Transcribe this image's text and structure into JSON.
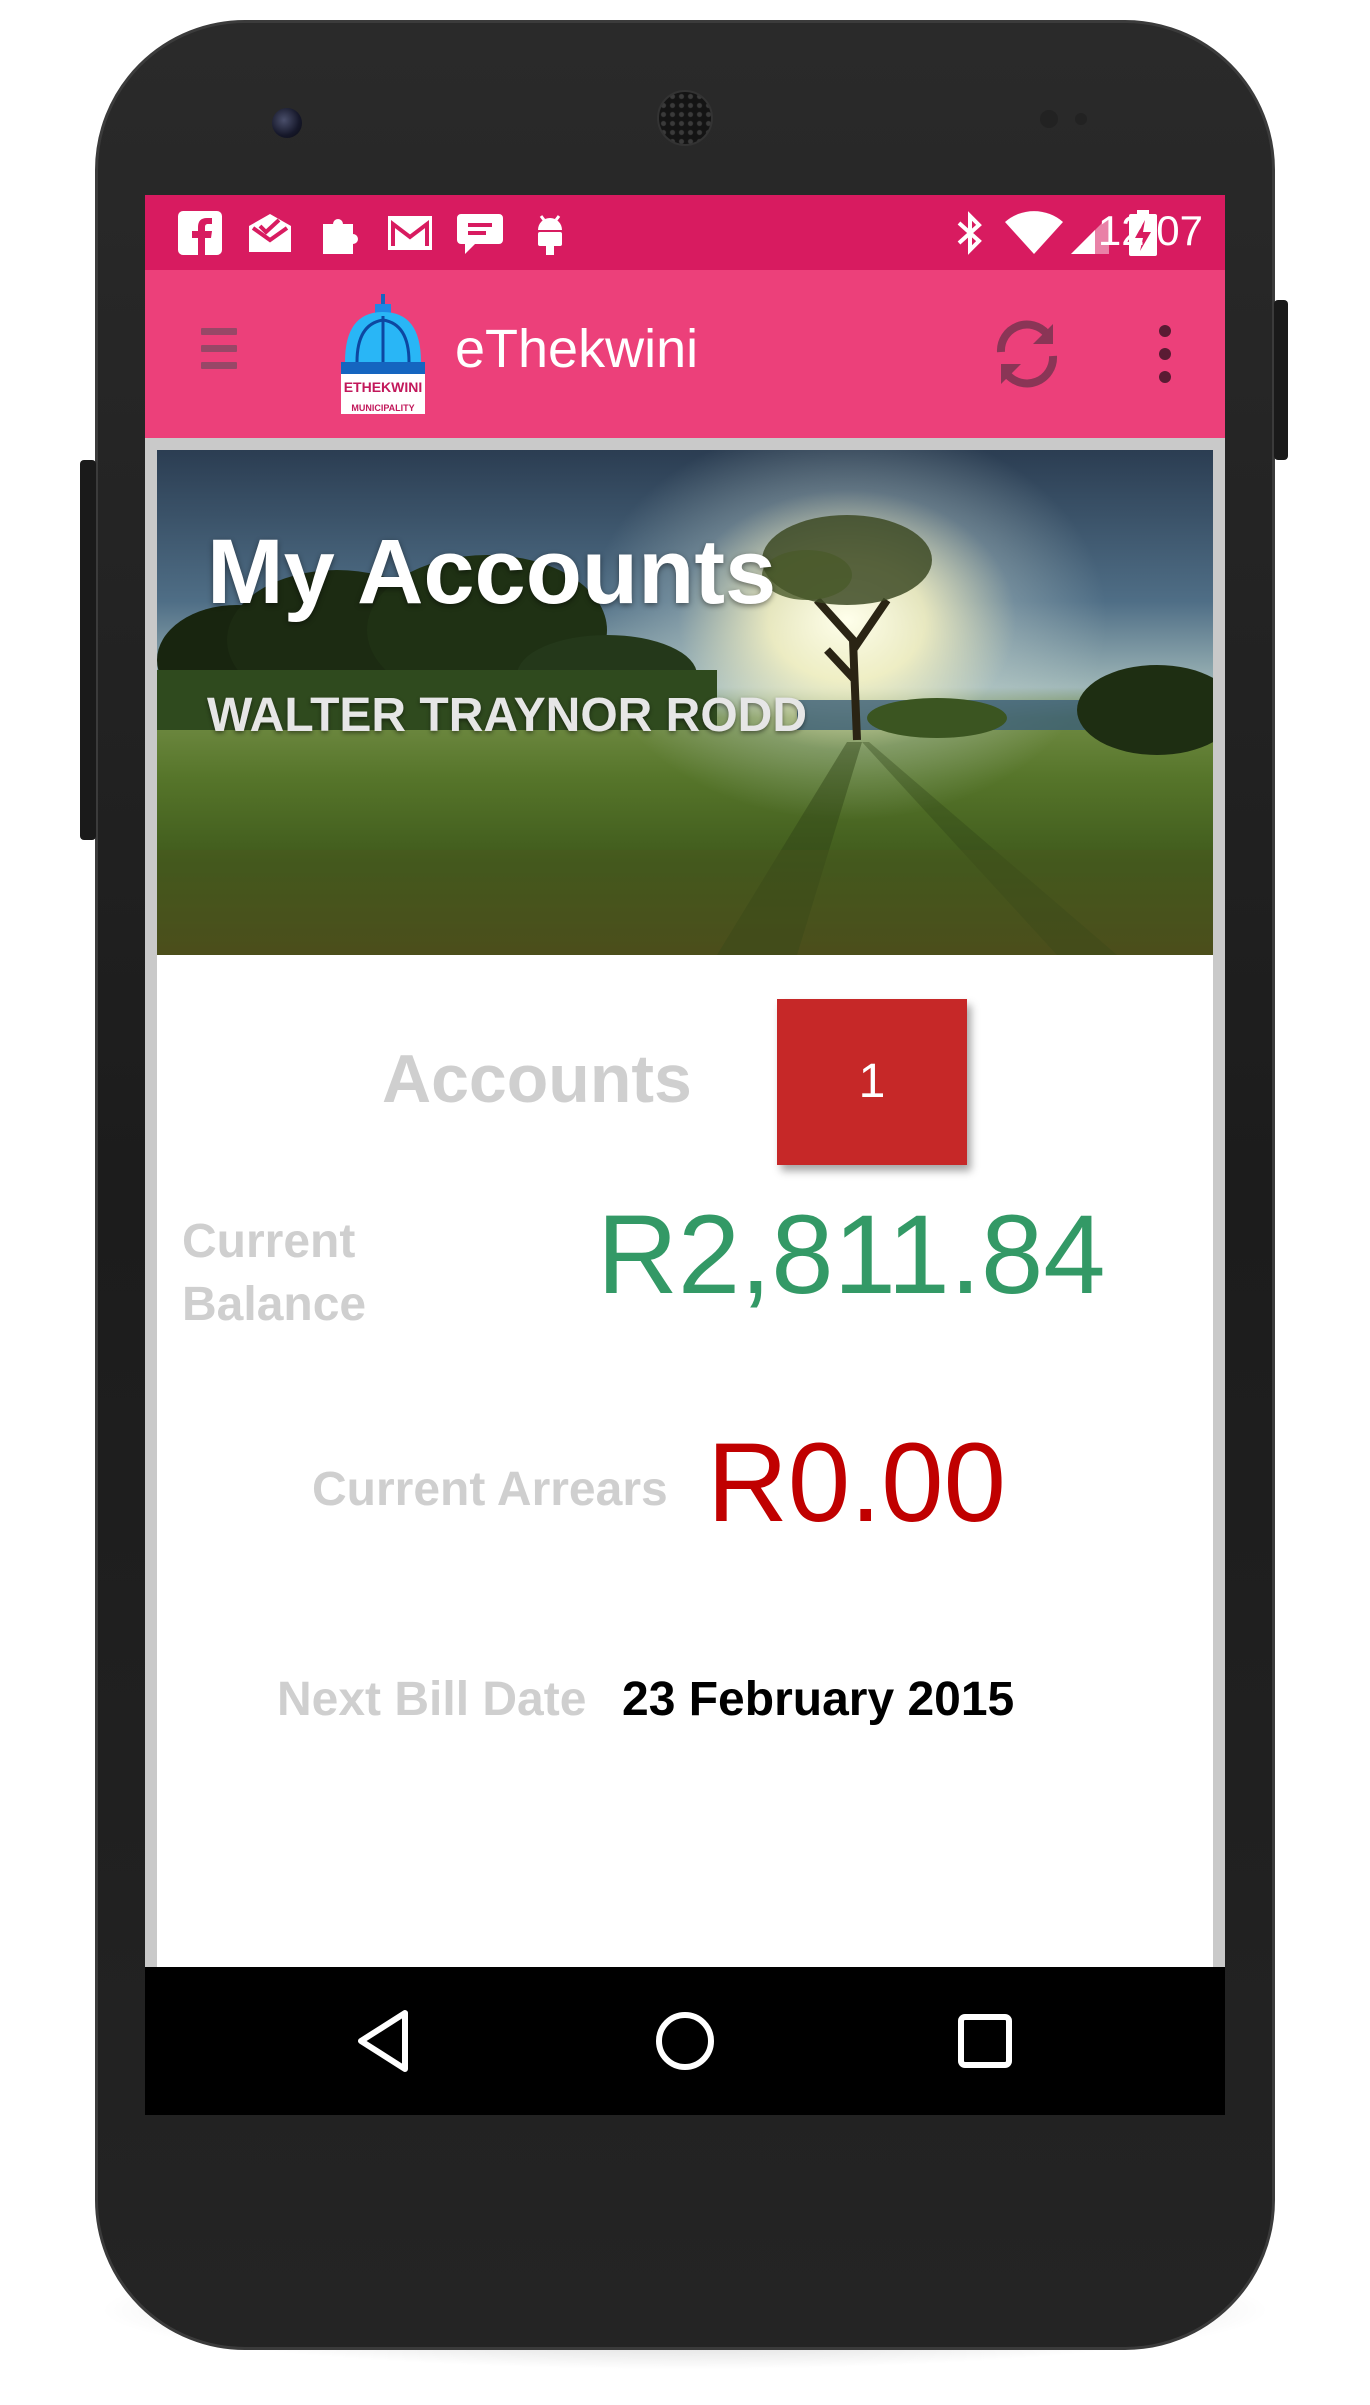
{
  "status_bar": {
    "time": "12:07",
    "notification_icons": [
      "facebook-icon",
      "mail-check-icon",
      "puzzle-icon",
      "gmail-icon",
      "chat-bubble-icon",
      "android-icon"
    ],
    "system_icons": [
      "bluetooth-icon",
      "wifi-icon",
      "signal-icon",
      "battery-charging-icon"
    ],
    "color": "#d81b60"
  },
  "app_bar": {
    "title": "eThekwini",
    "logo_text": "ETHEKWINI MUNICIPALITY",
    "color": "#ec407a",
    "actions": [
      "refresh-icon",
      "overflow-menu-icon"
    ]
  },
  "hero": {
    "title": "My Accounts",
    "subtitle": "WALTER TRAYNOR RODD"
  },
  "summary": {
    "accounts_label": "Accounts",
    "accounts_count": "1",
    "balance_label": "Current Balance",
    "balance_value": "R2,811.84",
    "arrears_label": "Current Arrears",
    "arrears_value": "R0.00",
    "bill_label": "Next Bill Date",
    "bill_value": "23 February 2015",
    "balance_color": "#339966",
    "arrears_color": "#c00000",
    "count_badge_color": "#c62828"
  },
  "nav_bar": {
    "buttons": [
      "back-icon",
      "home-icon",
      "recents-icon"
    ]
  }
}
